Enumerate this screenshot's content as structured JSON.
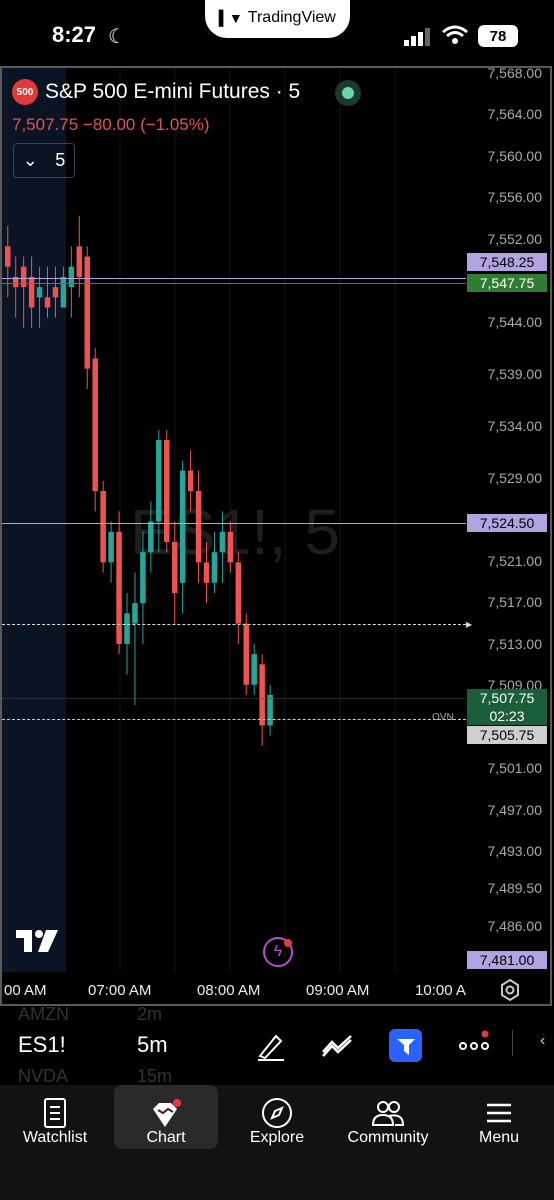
{
  "status_bar": {
    "time": "8:27",
    "app_name": "TradingView",
    "battery": "78"
  },
  "symbol": {
    "badge": "500",
    "title": "S&P 500 E-mini Futures · 5",
    "price_line": "7,507.75 −80.00 (−1.05%)",
    "interval": "5"
  },
  "watermark": "ES1!, 5",
  "price_axis": [
    "7,568.00",
    "7,564.00",
    "7,560.00",
    "7,556.00",
    "7,552.00",
    "7,544.00",
    "7,539.00",
    "7,534.00",
    "7,529.00",
    "7,521.00",
    "7,517.00",
    "7,513.00",
    "7,509.00",
    "7,501.00",
    "7,497.00",
    "7,493.00",
    "7,489.50",
    "7,486.00"
  ],
  "price_tags": [
    {
      "label": "7,548.25",
      "bg": "#b5a2e0",
      "fg": "#000000"
    },
    {
      "label": "7,547.75",
      "bg": "#2e7d32",
      "fg": "#ffffff"
    },
    {
      "label": "7,524.50",
      "bg": "#b5a2e0",
      "fg": "#000000"
    },
    {
      "label": "7,507.75",
      "bg": "#1b5e3a",
      "fg": "#ffffff"
    },
    {
      "label": "02:23",
      "bg": "#1b5e3a",
      "fg": "#ffffff"
    },
    {
      "label": "7,505.75",
      "bg": "#cfcfcf",
      "fg": "#000000"
    },
    {
      "label": "7,481.00",
      "bg": "#b5a2e0",
      "fg": "#000000"
    }
  ],
  "ovn_label": "OVN",
  "time_axis": [
    "00 AM",
    "07:00 AM",
    "08:00 AM",
    "09:00 AM",
    "10:00 A"
  ],
  "toolbar": {
    "symbol": "ES1!",
    "timeframe": "5m",
    "faded_top_symbol": "AMZN",
    "faded_top_tf": "2m",
    "faded_bottom_symbol": "NVDA",
    "faded_bottom_tf": "15m"
  },
  "nav": [
    {
      "label": "Watchlist",
      "icon": "watchlist-icon"
    },
    {
      "label": "Chart",
      "icon": "chart-icon"
    },
    {
      "label": "Explore",
      "icon": "compass-icon"
    },
    {
      "label": "Community",
      "icon": "community-icon"
    },
    {
      "label": "Menu",
      "icon": "menu-icon"
    }
  ],
  "colors": {
    "up": "#26a69a",
    "down": "#ef5350",
    "accent": "#2962ff"
  },
  "chart_data": {
    "type": "candlestick",
    "y_range": [
      7481,
      7568
    ],
    "candles": [
      {
        "o": 7551,
        "h": 7553,
        "l": 7546,
        "c": 7549
      },
      {
        "o": 7548,
        "h": 7550,
        "l": 7544,
        "c": 7547
      },
      {
        "o": 7549,
        "h": 7550,
        "l": 7543,
        "c": 7547
      },
      {
        "o": 7548,
        "h": 7550,
        "l": 7543,
        "c": 7545
      },
      {
        "o": 7546,
        "h": 7549,
        "l": 7543,
        "c": 7547
      },
      {
        "o": 7546,
        "h": 7549,
        "l": 7544,
        "c": 7545
      },
      {
        "o": 7547,
        "h": 7549,
        "l": 7544,
        "c": 7546
      },
      {
        "o": 7545,
        "h": 7549,
        "l": 7545,
        "c": 7548
      },
      {
        "o": 7547,
        "h": 7551,
        "l": 7544,
        "c": 7549
      },
      {
        "o": 7551,
        "h": 7554,
        "l": 7546,
        "c": 7548
      },
      {
        "o": 7550,
        "h": 7551,
        "l": 7537,
        "c": 7539
      },
      {
        "o": 7540,
        "h": 7541,
        "l": 7525,
        "c": 7527
      },
      {
        "o": 7527,
        "h": 7528,
        "l": 7519,
        "c": 7520
      },
      {
        "o": 7520,
        "h": 7524,
        "l": 7518,
        "c": 7523
      },
      {
        "o": 7523,
        "h": 7525,
        "l": 7511,
        "c": 7512
      },
      {
        "o": 7512,
        "h": 7517,
        "l": 7509,
        "c": 7515
      },
      {
        "o": 7514,
        "h": 7519,
        "l": 7506,
        "c": 7516
      },
      {
        "o": 7516,
        "h": 7523,
        "l": 7512,
        "c": 7521
      },
      {
        "o": 7521,
        "h": 7526,
        "l": 7519,
        "c": 7524
      },
      {
        "o": 7524,
        "h": 7533,
        "l": 7521,
        "c": 7532
      },
      {
        "o": 7532,
        "h": 7533,
        "l": 7521,
        "c": 7522
      },
      {
        "o": 7522,
        "h": 7524,
        "l": 7514,
        "c": 7517
      },
      {
        "o": 7518,
        "h": 7530,
        "l": 7515,
        "c": 7529
      },
      {
        "o": 7529,
        "h": 7531,
        "l": 7525,
        "c": 7527
      },
      {
        "o": 7527,
        "h": 7529,
        "l": 7518,
        "c": 7520
      },
      {
        "o": 7520,
        "h": 7522,
        "l": 7516,
        "c": 7518
      },
      {
        "o": 7518,
        "h": 7523,
        "l": 7517,
        "c": 7521
      },
      {
        "o": 7521,
        "h": 7525,
        "l": 7518,
        "c": 7523
      },
      {
        "o": 7523,
        "h": 7524,
        "l": 7519,
        "c": 7520
      },
      {
        "o": 7520,
        "h": 7521,
        "l": 7512,
        "c": 7514
      },
      {
        "o": 7514,
        "h": 7515,
        "l": 7507,
        "c": 7508
      },
      {
        "o": 7508,
        "h": 7512,
        "l": 7507,
        "c": 7511
      },
      {
        "o": 7510,
        "h": 7511,
        "l": 7502,
        "c": 7504
      },
      {
        "o": 7504,
        "h": 7508,
        "l": 7503,
        "c": 7507
      }
    ]
  }
}
